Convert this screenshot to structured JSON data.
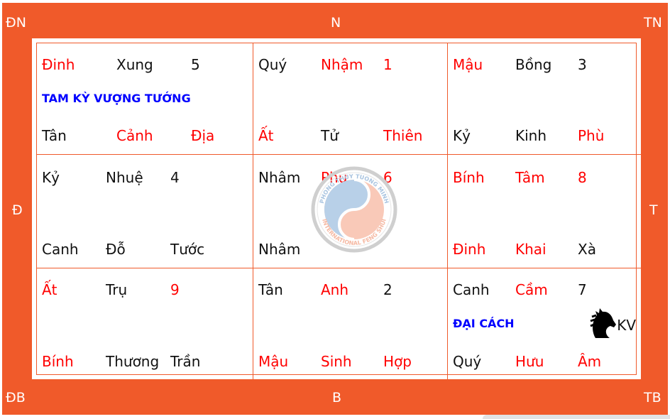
{
  "colors": {
    "frame": "#F05A2A",
    "red": "#FF0000",
    "blue": "#0000FF",
    "text": "#111111"
  },
  "directions": {
    "nw": "ĐN",
    "n": "N",
    "ne": "TN",
    "w": "Đ",
    "e": "T",
    "sw": "ĐB",
    "s": "B",
    "se": "TB"
  },
  "cells": [
    {
      "top": [
        {
          "t": "Đinh",
          "c": "red"
        },
        {
          "t": "Xung",
          "c": "blk"
        },
        {
          "t": "5",
          "c": "blk"
        }
      ],
      "mid": "TAM KỲ VƯỢNG TƯỚNG",
      "bot": [
        {
          "t": "Tân",
          "c": "blk"
        },
        {
          "t": "Cảnh",
          "c": "red"
        },
        {
          "t": "Địa",
          "c": "red"
        }
      ]
    },
    {
      "top": [
        {
          "t": "Quý",
          "c": "blk"
        },
        {
          "t": "Nhậm",
          "c": "red"
        },
        {
          "t": "1",
          "c": "red"
        }
      ],
      "bot": [
        {
          "t": "Ất",
          "c": "red"
        },
        {
          "t": "Tử",
          "c": "blk"
        },
        {
          "t": "Thiên",
          "c": "red"
        }
      ]
    },
    {
      "top": [
        {
          "t": "Mậu",
          "c": "red"
        },
        {
          "t": "Bồng",
          "c": "blk"
        },
        {
          "t": "3",
          "c": "blk"
        }
      ],
      "bot": [
        {
          "t": "Kỷ",
          "c": "blk"
        },
        {
          "t": "Kinh",
          "c": "blk"
        },
        {
          "t": "Phù",
          "c": "red"
        }
      ]
    },
    {
      "top": [
        {
          "t": "Kỷ",
          "c": "blk"
        },
        {
          "t": "Nhuệ",
          "c": "blk"
        },
        {
          "t": "4",
          "c": "blk"
        }
      ],
      "bot": [
        {
          "t": "Canh",
          "c": "blk"
        },
        {
          "t": "Đỗ",
          "c": "blk"
        },
        {
          "t": "Tước",
          "c": "blk"
        }
      ]
    },
    {
      "top": [
        {
          "t": "Nhâm",
          "c": "blk"
        },
        {
          "t": "Phụ",
          "c": "red"
        },
        {
          "t": "6",
          "c": "red"
        }
      ],
      "bot": [
        {
          "t": "Nhâm",
          "c": "blk"
        },
        {
          "t": "",
          "c": "blk"
        },
        {
          "t": "",
          "c": "blk"
        }
      ]
    },
    {
      "top": [
        {
          "t": "Bính",
          "c": "red"
        },
        {
          "t": "Tâm",
          "c": "red"
        },
        {
          "t": "8",
          "c": "red"
        }
      ],
      "bot": [
        {
          "t": "Đinh",
          "c": "red"
        },
        {
          "t": "Khai",
          "c": "red"
        },
        {
          "t": "Xà",
          "c": "blk"
        }
      ]
    },
    {
      "top": [
        {
          "t": "Ất",
          "c": "red"
        },
        {
          "t": "Trụ",
          "c": "blk"
        },
        {
          "t": "9",
          "c": "red"
        }
      ],
      "bot": [
        {
          "t": "Bính",
          "c": "red"
        },
        {
          "t": "Thương",
          "c": "blk"
        },
        {
          "t": "Trần",
          "c": "blk"
        }
      ]
    },
    {
      "top": [
        {
          "t": "Tân",
          "c": "blk"
        },
        {
          "t": "Anh",
          "c": "red"
        },
        {
          "t": "2",
          "c": "blk"
        }
      ],
      "bot": [
        {
          "t": "Mậu",
          "c": "red"
        },
        {
          "t": "Sinh",
          "c": "red"
        },
        {
          "t": "Hợp",
          "c": "red"
        }
      ]
    },
    {
      "top": [
        {
          "t": "Canh",
          "c": "blk"
        },
        {
          "t": "Cầm",
          "c": "red"
        },
        {
          "t": "7",
          "c": "blk"
        }
      ],
      "mid": "ĐẠI CÁCH",
      "kv": "KV",
      "kv_icon": "horse-icon",
      "bot": [
        {
          "t": "Quý",
          "c": "blk"
        },
        {
          "t": "Hưu",
          "c": "red"
        },
        {
          "t": "Âm",
          "c": "red"
        }
      ]
    }
  ],
  "watermark": {
    "top_text": "PHONG THUY TUONG MINH",
    "bottom_text": "INTERNATIONAL FENG SHUI"
  }
}
